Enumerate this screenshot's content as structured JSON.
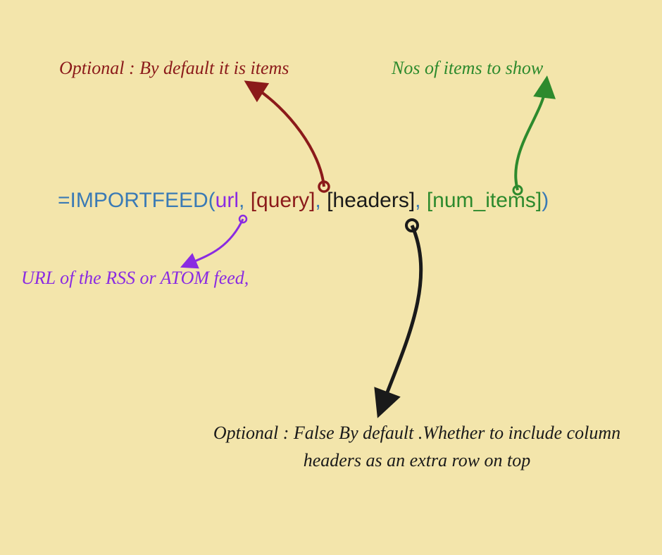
{
  "annotations": {
    "query": "Optional : By default it is items",
    "numitems": "Nos of items to show",
    "url": "URL of the RSS or ATOM feed,",
    "headers": "Optional : False By default .Whether to include column headers as an extra row on top"
  },
  "formula": {
    "eq": "=",
    "fn": "IMPORTFEED",
    "open": "(",
    "url": "url",
    "c1": ", ",
    "query": "[query]",
    "c2": ", ",
    "headers": "[headers]",
    "c3": ", ",
    "numitems": "[num_items]",
    "close": ")"
  }
}
